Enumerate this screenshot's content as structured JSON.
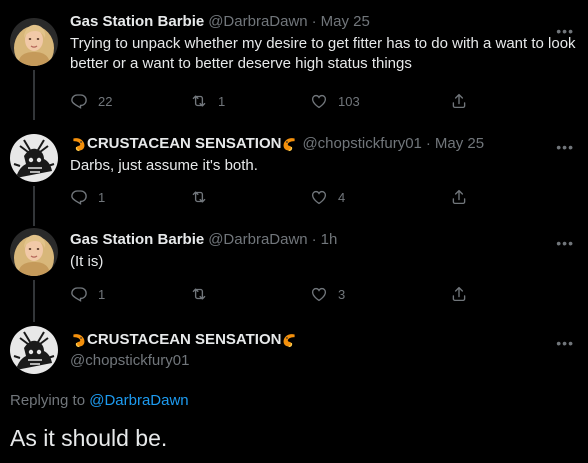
{
  "colors": {
    "background": "#000000",
    "text": "#e7e9ea",
    "secondary": "#71767b",
    "link": "#1d9bf0",
    "thread_line": "#333639"
  },
  "tweets": [
    {
      "name": "Gas Station Barbie",
      "handle": "@DarbraDawn",
      "time": "May 25",
      "text": "Trying to unpack whether my desire to get fitter has to do with a want to look better or a want to better deserve high status things",
      "replies": "22",
      "retweets": "1",
      "likes": "103"
    },
    {
      "name": "CRUSTACEAN SENSATION",
      "handle": "@chopstickfury01",
      "time": "May 25",
      "text": "Darbs, just assume it's both.",
      "replies": "1",
      "retweets": "",
      "likes": "4"
    },
    {
      "name": "Gas Station Barbie",
      "handle": "@DarbraDawn",
      "time": "1h",
      "text": "(It is)",
      "replies": "1",
      "retweets": "",
      "likes": "3"
    }
  ],
  "main_tweet": {
    "name": "CRUSTACEAN SENSATION",
    "handle": "@chopstickfury01",
    "replying_label": "Replying to",
    "replying_to": "@DarbraDawn",
    "text": "As it should be."
  },
  "icons": {
    "more": "more-dots-icon",
    "reply": "reply-icon",
    "retweet": "retweet-icon",
    "like": "heart-icon",
    "share": "share-icon",
    "name_emoji": "shrimp-emoji-icon"
  }
}
